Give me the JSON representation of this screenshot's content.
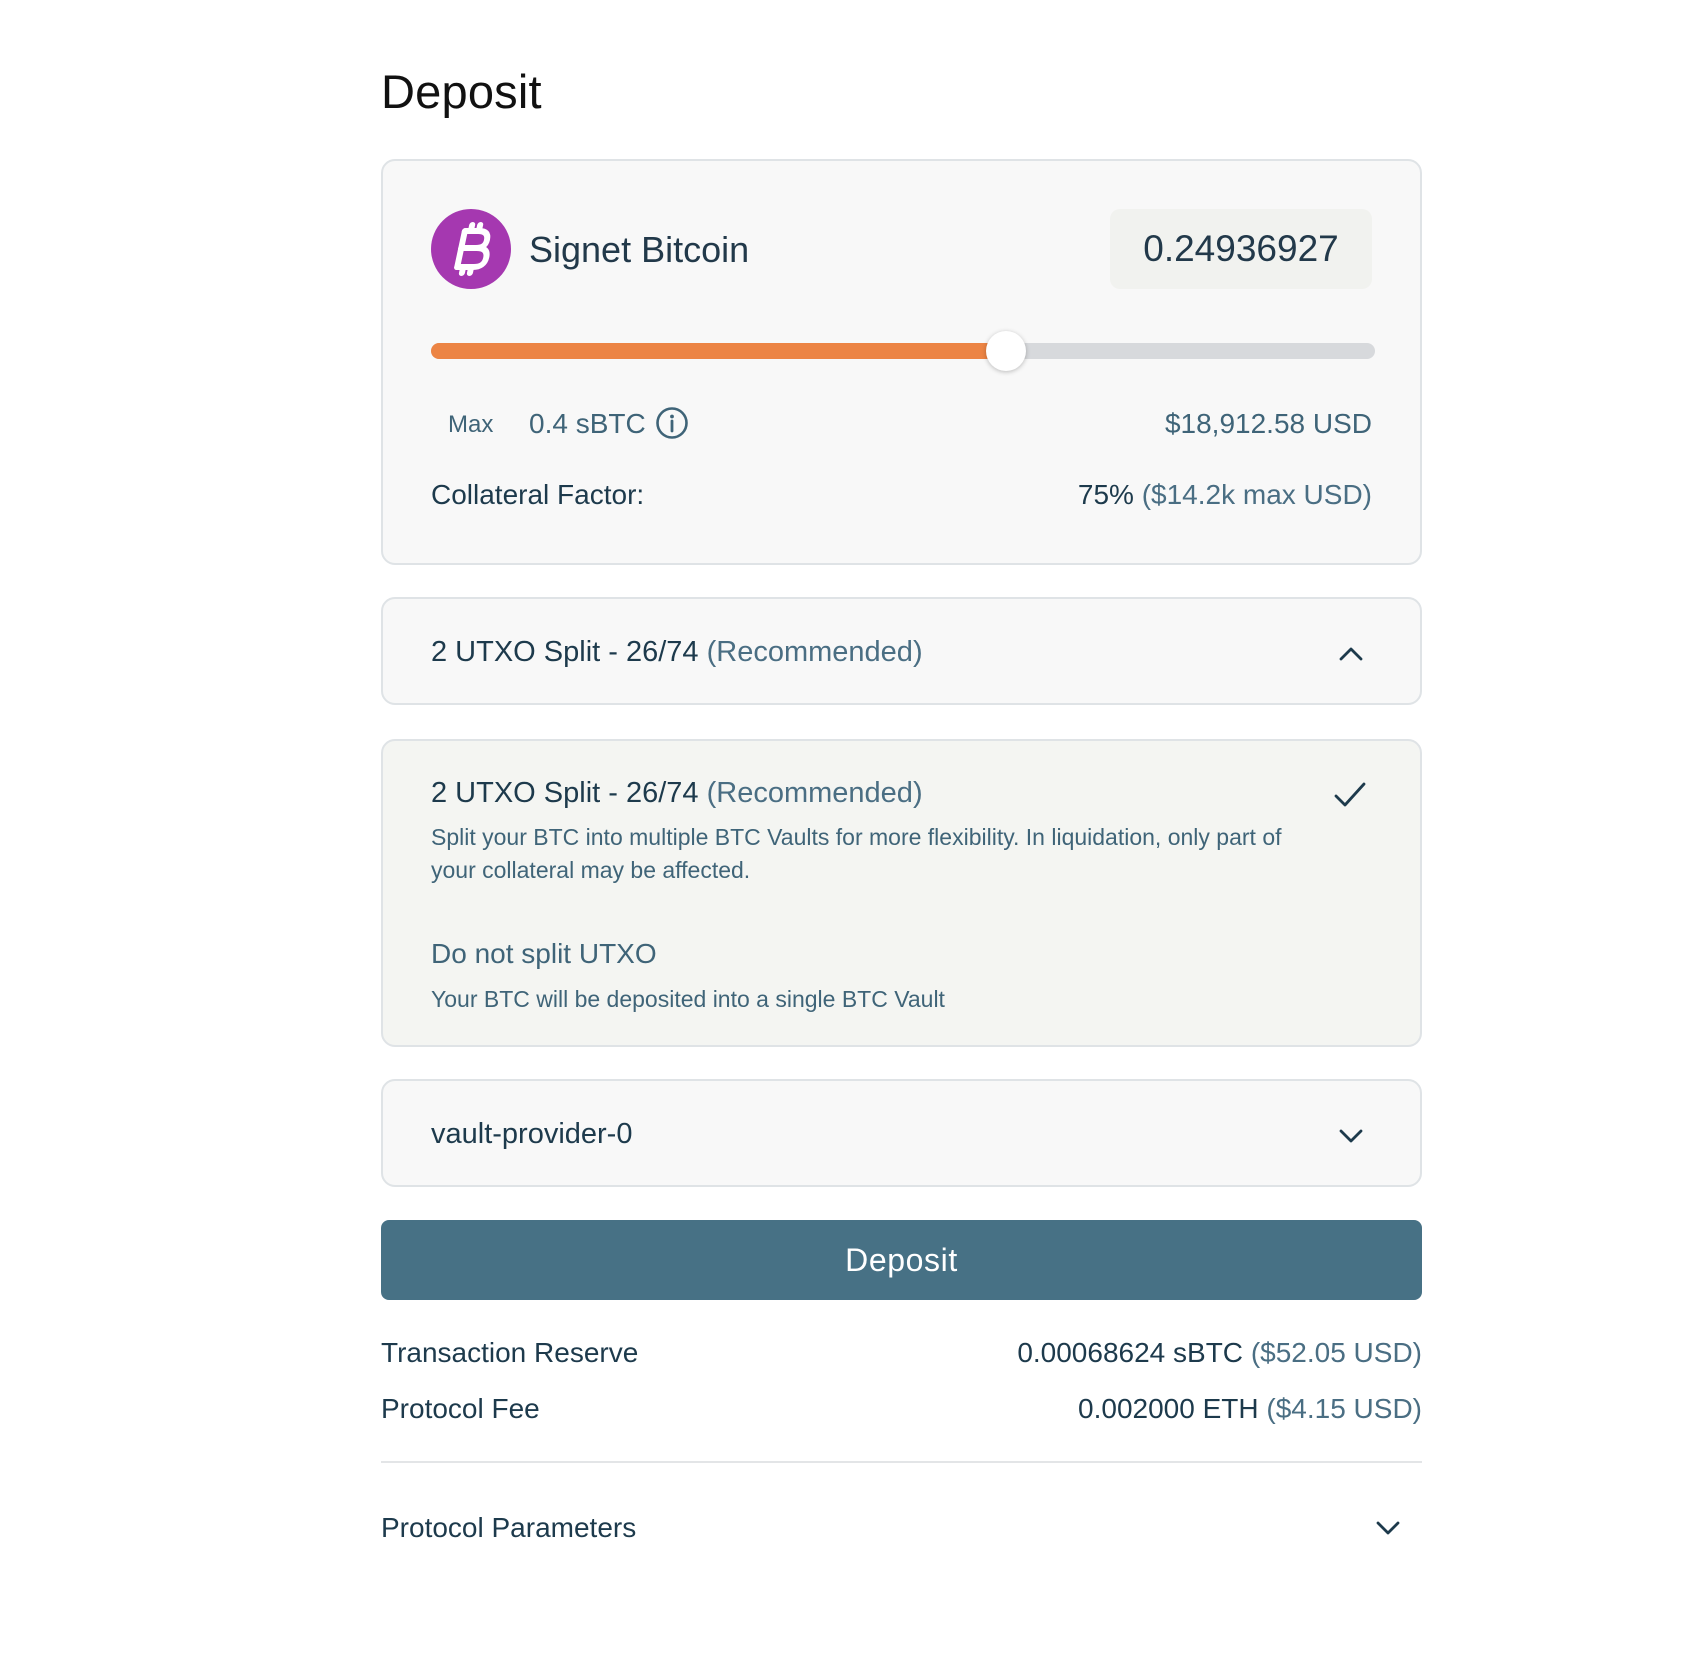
{
  "page": {
    "title": "Deposit"
  },
  "asset": {
    "logo_icon": "bitcoin-icon",
    "logo_color": "#a538b0",
    "name": "Signet Bitcoin",
    "amount": "0.24936927"
  },
  "slider": {
    "fraction": 0.609,
    "fill_color": "#ec8444"
  },
  "balance": {
    "max_label": "Max",
    "max_value": "0.4 sBTC",
    "usd_value": "$18,912.58 USD"
  },
  "collateral": {
    "label": "Collateral Factor:",
    "percent": "75%",
    "max_usd": "($14.2k max USD)"
  },
  "split_dropdown": {
    "selected": "2 UTXO Split - 26/74",
    "tag": "(Recommended)",
    "icon": "chevron-up-icon"
  },
  "split_options": [
    {
      "title": "2 UTXO Split - 26/74",
      "tag": "(Recommended)",
      "description": "Split your BTC into multiple BTC Vaults for more flexibility. In liquidation, only part of your collateral may be affected.",
      "selected_icon": "check-icon"
    },
    {
      "title": "Do not split UTXO",
      "description": "Your BTC will be deposited into a single BTC Vault"
    }
  ],
  "provider_dropdown": {
    "selected": "vault-provider-0",
    "icon": "chevron-down-icon"
  },
  "deposit_button": {
    "label": "Deposit",
    "color": "#477185"
  },
  "fees": {
    "reserve_label": "Transaction Reserve",
    "reserve_value": "0.00068624 sBTC",
    "reserve_usd": "($52.05 USD)",
    "fee_label": "Protocol Fee",
    "fee_value": "0.002000 ETH",
    "fee_usd": "($4.15 USD)"
  },
  "parameters": {
    "label": "Protocol Parameters",
    "icon": "chevron-down-icon"
  }
}
